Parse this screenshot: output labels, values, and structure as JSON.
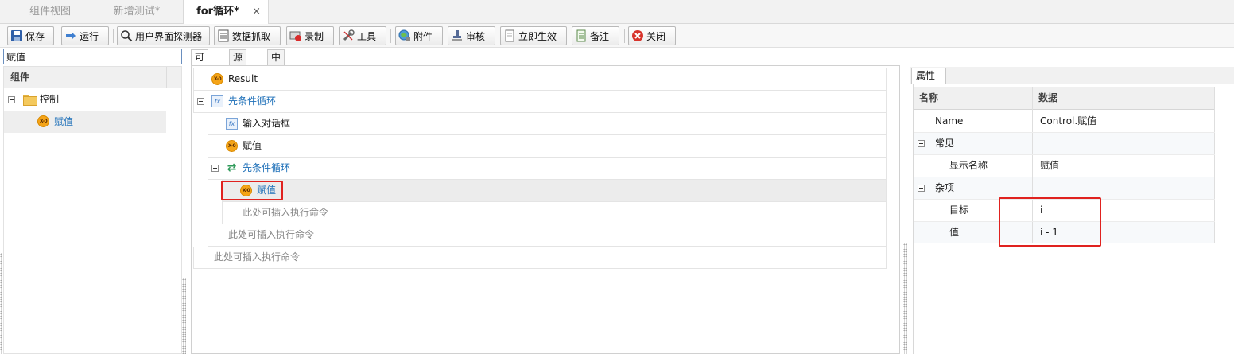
{
  "doc_tabs": [
    {
      "label": "组件视图",
      "active": false
    },
    {
      "label": "新增测试*",
      "active": false
    },
    {
      "label": "for循环*",
      "active": true
    }
  ],
  "doc_tab_close": "×",
  "toolbar": {
    "save": "保存",
    "run": "运行",
    "ui_probe": "用户界面探测器",
    "data_capture": "数据抓取",
    "record": "录制",
    "tools": "工具",
    "attachment": "附件",
    "review": "审核",
    "apply_now": "立即生效",
    "note": "备注",
    "close": "关闭"
  },
  "left": {
    "search_value": "赋值",
    "header": "组件",
    "tree": [
      {
        "label": "控制",
        "type": "folder"
      },
      {
        "label": "赋值",
        "type": "assign",
        "selected": true
      }
    ]
  },
  "center": {
    "view_tabs": [
      "可视化",
      "源代码",
      "中文格式"
    ],
    "rows": {
      "result": "Result",
      "loop_outer": "先条件循环",
      "input_dialog": "输入对话框",
      "assign1": "赋值",
      "loop_inner": "先条件循环",
      "assign2": "赋值",
      "insert_inner": "此处可插入执行命令",
      "insert_outer": "此处可插入执行命令",
      "insert_root": "此处可插入执行命令"
    },
    "assign_icon_text": "X-0"
  },
  "right": {
    "tab": "属性",
    "col_name": "名称",
    "col_data": "数据",
    "rows": {
      "name_label": "Name",
      "name_value": "Control.赋值",
      "common": "常见",
      "display_name_label": "显示名称",
      "display_name_value": "赋值",
      "misc": "杂项",
      "target_label": "目标",
      "target_value": "i",
      "value_label": "值",
      "value_value": "i - 1"
    }
  },
  "colors": {
    "highlight": "#e0221f",
    "link_blue": "#1d6fb8",
    "assign_orange": "#f5a417"
  }
}
